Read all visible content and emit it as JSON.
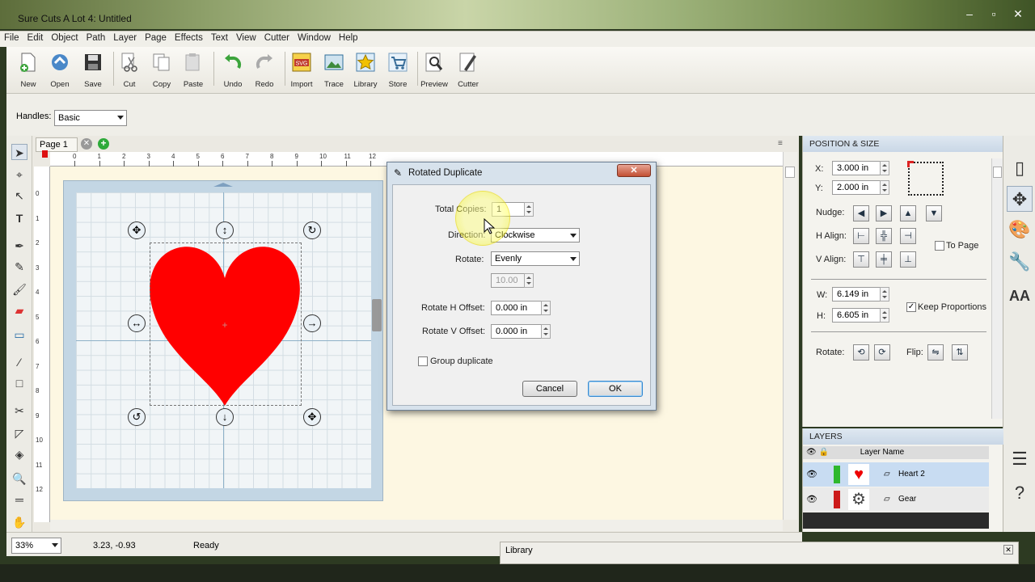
{
  "window": {
    "title": "Sure Cuts A Lot 4: Untitled"
  },
  "menu": [
    "File",
    "Edit",
    "Object",
    "Path",
    "Layer",
    "Page",
    "Effects",
    "Text",
    "View",
    "Cutter",
    "Window",
    "Help"
  ],
  "toolbar": {
    "new": "New",
    "open": "Open",
    "save": "Save",
    "cut": "Cut",
    "copy": "Copy",
    "paste": "Paste",
    "undo": "Undo",
    "redo": "Redo",
    "import": "Import",
    "trace": "Trace",
    "library": "Library",
    "store": "Store",
    "preview": "Preview",
    "cutter": "Cutter",
    "import_badge": "SVG"
  },
  "handles": {
    "label": "Handles:",
    "value": "Basic"
  },
  "page_tab": {
    "label": "Page 1"
  },
  "ruler_h": [
    "0",
    "1",
    "2",
    "3",
    "4",
    "5",
    "6",
    "7",
    "8",
    "9",
    "10",
    "11",
    "12"
  ],
  "ruler_v": [
    "0",
    "1",
    "2",
    "3",
    "4",
    "5",
    "6",
    "7",
    "8",
    "9",
    "10",
    "11",
    "12"
  ],
  "status": {
    "zoom": "33%",
    "coords": "3.23, -0.93",
    "state": "Ready"
  },
  "position_size": {
    "title": "POSITION & SIZE",
    "x_label": "X:",
    "x_value": "3.000 in",
    "y_label": "Y:",
    "y_value": "2.000 in",
    "nudge_label": "Nudge:",
    "halign_label": "H Align:",
    "valign_label": "V Align:",
    "to_page": "To Page",
    "w_label": "W:",
    "w_value": "6.149 in",
    "h_label": "H:",
    "h_value": "6.605 in",
    "keep_proportions": "Keep Proportions",
    "keep_proportions_checked": true,
    "rotate_label": "Rotate:",
    "flip_label": "Flip:"
  },
  "layers": {
    "title": "LAYERS",
    "column": "Layer Name",
    "items": [
      {
        "name": "Heart 2",
        "color": "#2eb82e",
        "selected": true
      },
      {
        "name": "Gear",
        "color": "#cc1a1a",
        "selected": false
      }
    ]
  },
  "library": {
    "title": "Library"
  },
  "dialog": {
    "title": "Rotated Duplicate",
    "total_copies_label": "Total Copies:",
    "total_copies_value": "1",
    "direction_label": "Direction:",
    "direction_value": "Clockwise",
    "rotate_label": "Rotate:",
    "rotate_value": "Evenly",
    "angle_value": "10.00",
    "h_offset_label": "Rotate H Offset:",
    "h_offset_value": "0.000 in",
    "v_offset_label": "Rotate V Offset:",
    "v_offset_value": "0.000 in",
    "group_label": "Group duplicate",
    "group_checked": false,
    "cancel": "Cancel",
    "ok": "OK"
  },
  "colors": {
    "heart": "#ff0000",
    "accent": "#c9d7e6"
  }
}
